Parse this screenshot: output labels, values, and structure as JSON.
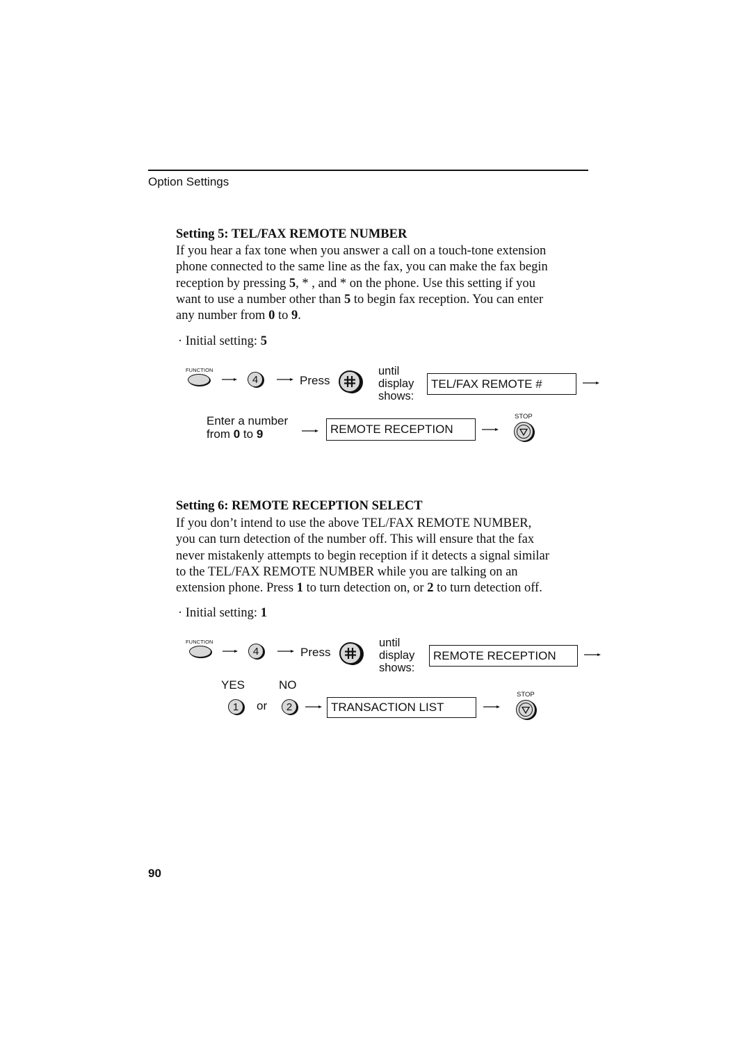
{
  "header": {
    "section_title": "Option Settings"
  },
  "setting5": {
    "heading": "Setting 5: TEL/FAX REMOTE NUMBER",
    "paragraph_lines": [
      [
        {
          "t": "If you hear a fax tone when you answer a call on a touch-tone extension"
        }
      ],
      [
        {
          "t": "phone connected to the same line as the fax, you can make the fax begin"
        }
      ],
      [
        {
          "t": "reception by pressing "
        },
        {
          "t": "5",
          "b": true
        },
        {
          "t": ", * , and *  on the phone. Use this setting if you"
        }
      ],
      [
        {
          "t": "want to use a number other than "
        },
        {
          "t": "5",
          "b": true
        },
        {
          "t": " to begin fax reception. You can enter"
        }
      ],
      [
        {
          "t": "any number from "
        },
        {
          "t": "0",
          "b": true
        },
        {
          "t": " to "
        },
        {
          "t": "9",
          "b": true
        },
        {
          "t": "."
        }
      ]
    ],
    "initial_setting_label": "Initial setting: ",
    "initial_setting_value": "5",
    "bullet": "·",
    "steps": {
      "function_label": "FUNCTION",
      "key_4": "4",
      "press_label": "Press",
      "hash_key": "#",
      "until_line1": "until",
      "until_line2": "display",
      "until_line3": "shows:",
      "display_1": "TEL/FAX REMOTE #",
      "enter_line1": "Enter a number",
      "enter_from": "from ",
      "enter_0": "0",
      "enter_to": " to ",
      "enter_9": "9",
      "display_2": "REMOTE RECEPTION",
      "stop_label": "STOP"
    }
  },
  "setting6": {
    "heading": "Setting 6: REMOTE RECEPTION SELECT",
    "paragraph_lines": [
      [
        {
          "t": "If you don’t intend to use the above TEL/FAX REMOTE NUMBER,"
        }
      ],
      [
        {
          "t": "you can turn detection of the number off. This will ensure that the fax"
        }
      ],
      [
        {
          "t": "never mistakenly attempts to begin reception if it detects a signal similar"
        }
      ],
      [
        {
          "t": "to the TEL/FAX REMOTE NUMBER while you are talking on an"
        }
      ],
      [
        {
          "t": "extension phone. Press "
        },
        {
          "t": "1",
          "b": true
        },
        {
          "t": " to turn detection on, or "
        },
        {
          "t": "2",
          "b": true
        },
        {
          "t": " to turn detection off."
        }
      ]
    ],
    "initial_setting_label": "Initial setting: ",
    "initial_setting_value": "1",
    "bullet": "·",
    "steps": {
      "function_label": "FUNCTION",
      "key_4": "4",
      "press_label": "Press",
      "hash_key": "#",
      "until_line1": "until",
      "until_line2": "display",
      "until_line3": "shows:",
      "display_1": "REMOTE RECEPTION",
      "yes_label": "YES",
      "no_label": "NO",
      "key_1": "1",
      "or_label": "or",
      "key_2": "2",
      "display_2": "TRANSACTION LIST",
      "stop_label": "STOP"
    }
  },
  "footer": {
    "page_number": "90"
  }
}
